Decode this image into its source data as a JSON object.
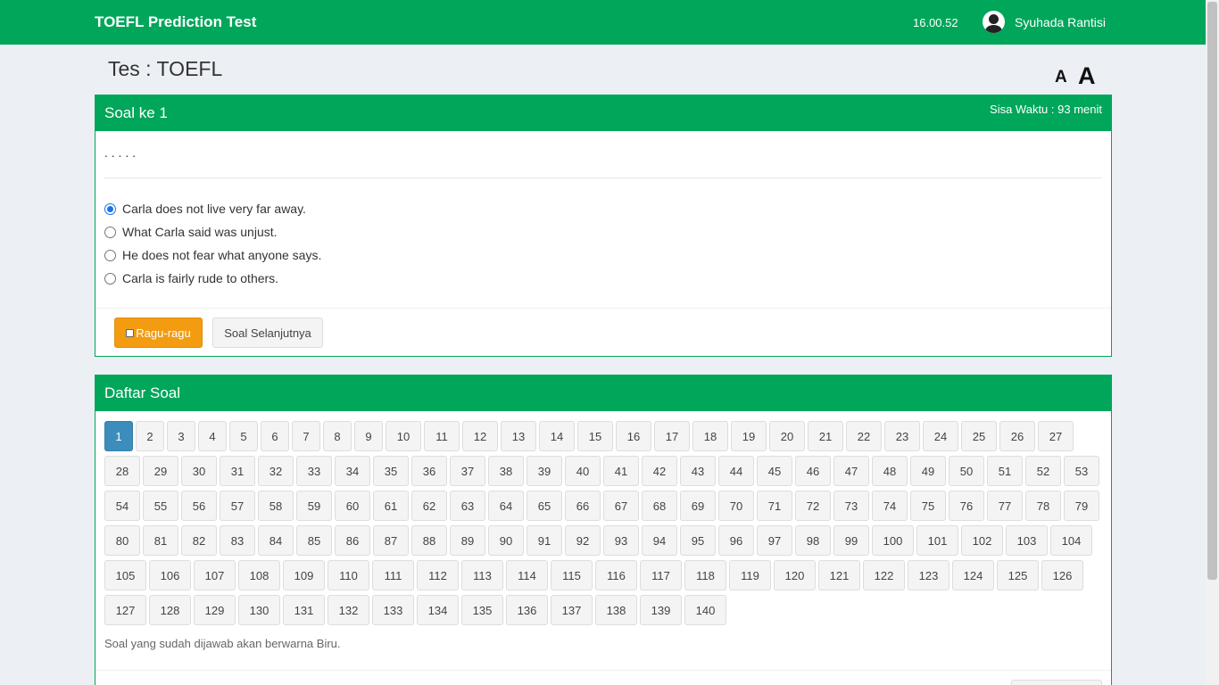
{
  "header": {
    "brand": "TOEFL Prediction Test",
    "clock": "16.00.52",
    "user_name": "Syuhada Rantisi"
  },
  "page": {
    "title": "Tes : TOEFL",
    "font_small_label": "A",
    "font_large_label": "A"
  },
  "question": {
    "heading": "Soal ke 1",
    "timer": "Sisa Waktu : 93 menit",
    "text": ". . . . .",
    "options": [
      {
        "label": "Carla does not live very far away.",
        "checked": true
      },
      {
        "label": "What Carla said was unjust.",
        "checked": false
      },
      {
        "label": "He does not fear what anyone says.",
        "checked": false
      },
      {
        "label": "Carla is fairly rude to others.",
        "checked": false
      }
    ],
    "ragu_label": "Ragu-ragu",
    "next_label": "Soal Selanjutnya"
  },
  "question_list": {
    "heading": "Daftar Soal",
    "total": 140,
    "active": 1,
    "note": "Soal yang sudah dijawab akan berwarna Biru."
  },
  "colors": {
    "primary_green": "#00a65a",
    "active_blue": "#3c8dbc",
    "ragu_orange": "#f39c12"
  }
}
